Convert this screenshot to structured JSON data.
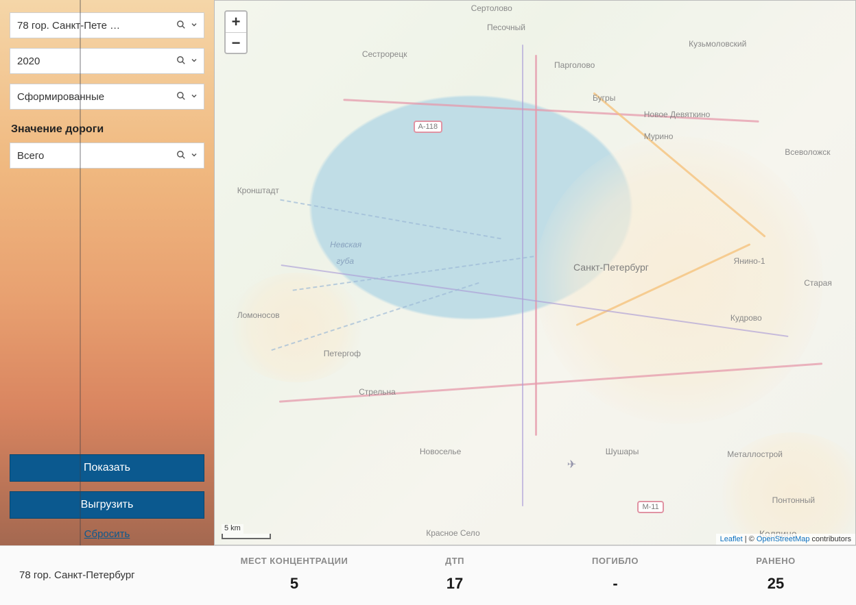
{
  "sidebar": {
    "filters": {
      "region": "78 гор. Санкт-Пете …",
      "year": "2020",
      "status": "Сформированные",
      "road_significance_label": "Значение дороги",
      "road_significance": "Всего"
    },
    "actions": {
      "show": "Показать",
      "export": "Выгрузить",
      "reset": "Сбросить"
    }
  },
  "map": {
    "zoom_in": "+",
    "zoom_out": "−",
    "scale": "5 km",
    "attribution_prefix": "Leaflet",
    "attribution_sep": " | © ",
    "attribution_osm": "OpenStreetMap",
    "attribution_suffix": " contributors",
    "labels": {
      "city_main": "Санкт-Петербург",
      "nevskaya1": "Невская",
      "nevskaya2": "губа",
      "kronstadt": "Кронштадт",
      "sestroretsk": "Сестрорецк",
      "pesochny": "Песочный",
      "pargolovo": "Парголово",
      "sertolovo": "Сертолово",
      "kuzmolovsky": "Кузьмоловский",
      "bugry": "Бугры",
      "devyatkino": "Новое Девяткино",
      "murino": "Мурино",
      "vsevolozhsk": "Всеволожск",
      "yanino": "Янино-1",
      "staraya": "Старая",
      "kudrovo": "Кудрово",
      "metallostroy": "Металлострой",
      "pontonny": "Понтонный",
      "kolpino": "Колпино",
      "shushary": "Шушары",
      "novoselie": "Новоселье",
      "krasnoe": "Красное Село",
      "strelna": "Стрельна",
      "petergof": "Петергоф",
      "lomonosov": "Ломоносов",
      "a118": "А-118",
      "m11": "М-11"
    }
  },
  "stats": {
    "region_name": "78 гор. Санкт-Петербург",
    "headers": {
      "places": "МЕСТ КОНЦЕНТРАЦИИ",
      "accidents": "ДТП",
      "deaths": "ПОГИБЛО",
      "injured": "РАНЕНО"
    },
    "values": {
      "places": "5",
      "accidents": "17",
      "deaths": "-",
      "injured": "25"
    }
  }
}
